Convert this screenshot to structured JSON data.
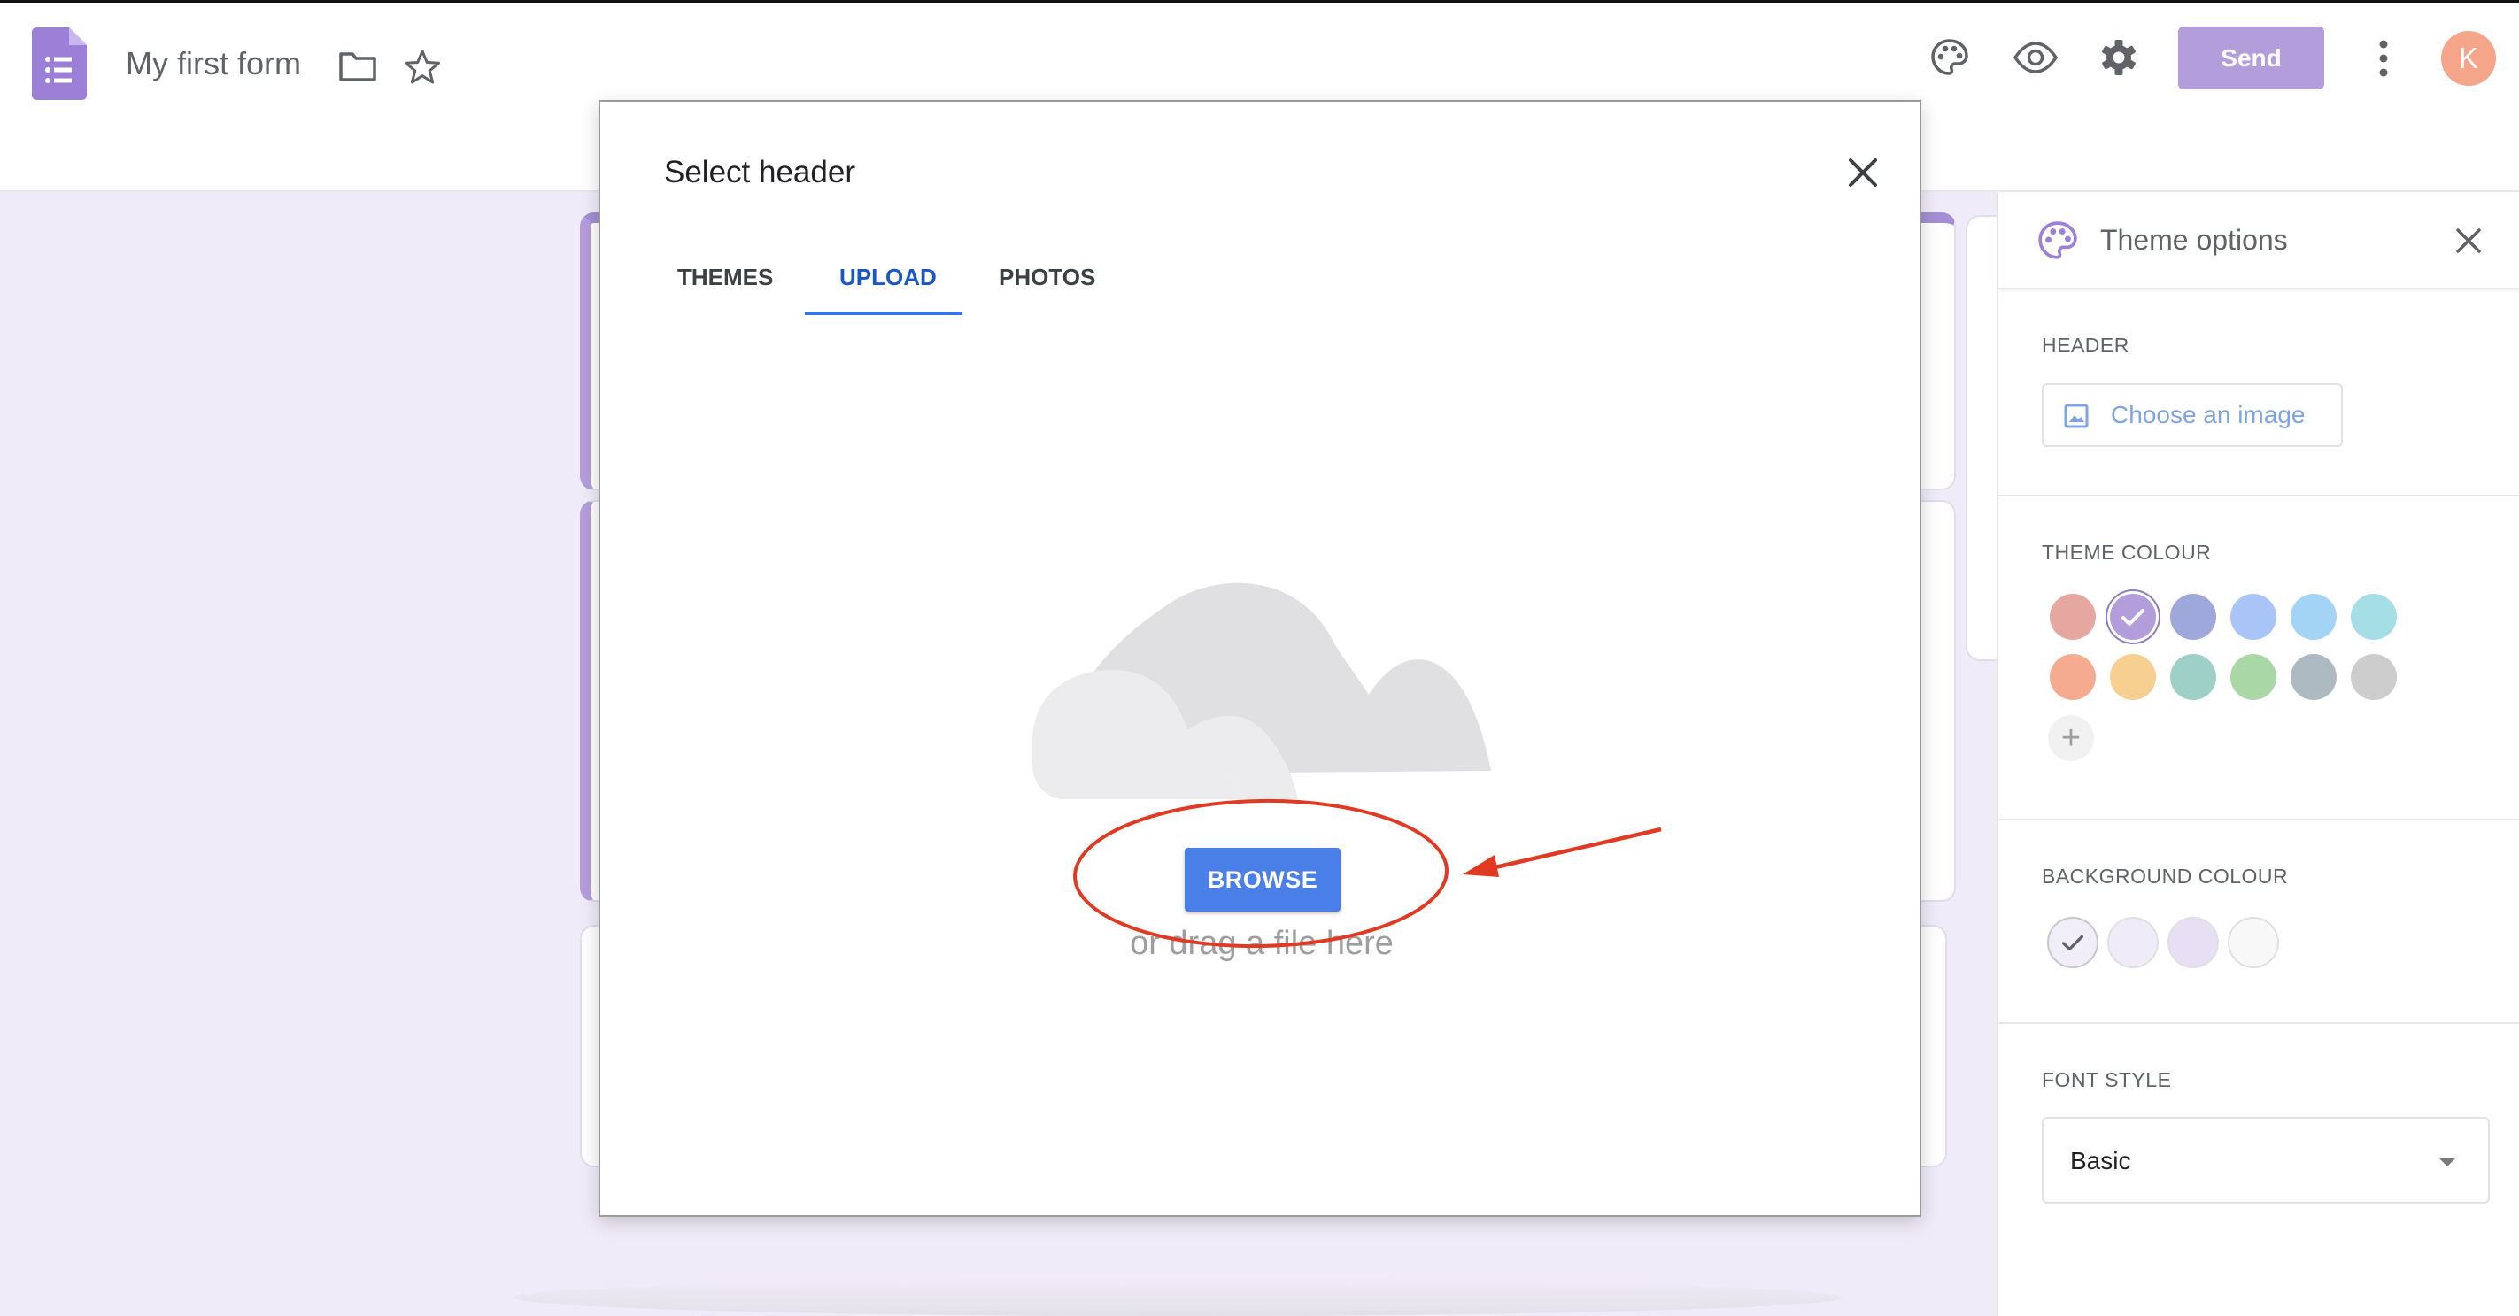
{
  "header": {
    "doc_title": "My first form",
    "send_label": "Send",
    "avatar_initial": "K",
    "icons": [
      "forms-logo-icon",
      "folder-icon",
      "star-icon",
      "palette-icon",
      "eye-icon",
      "gear-icon",
      "more-vert-icon"
    ]
  },
  "dialog": {
    "title": "Select header",
    "tabs": [
      {
        "label": "THEMES",
        "active": false
      },
      {
        "label": "UPLOAD",
        "active": true
      },
      {
        "label": "PHOTOS",
        "active": false
      }
    ],
    "browse_label": "BROWSE",
    "drag_text": "or drag a file here",
    "icons": [
      "close-icon",
      "cloud-upload-illustration"
    ]
  },
  "theme_panel": {
    "title": "Theme options",
    "header_label": "HEADER",
    "choose_image_label": "Choose an image",
    "theme_colour_label": "THEME COLOUR",
    "theme_colours": [
      "#e6a7a1",
      "#b39ddb",
      "#9fa8da",
      "#a9c4f7",
      "#a4d4f5",
      "#a6dee6",
      "#f4ab90",
      "#f6cf91",
      "#9ed0c7",
      "#a9d8a6",
      "#aebac2",
      "#cdcdcd"
    ],
    "selected_theme_colour": "#b39ddb",
    "add_colour_label": "+",
    "background_colour_label": "BACKGROUND COLOUR",
    "background_colours": [
      "#f1eef9",
      "#f0ebf8",
      "#e7dff4",
      "#f8f8f8"
    ],
    "selected_background_colour": "#f1eef9",
    "font_style_label": "FONT STYLE",
    "font_style_value": "Basic"
  },
  "colors": {
    "accent": "#b39ddb",
    "canvas_background": "#f0ebf8",
    "browse_blue": "#4b7fe8",
    "annotation_red": "#e03a22"
  }
}
